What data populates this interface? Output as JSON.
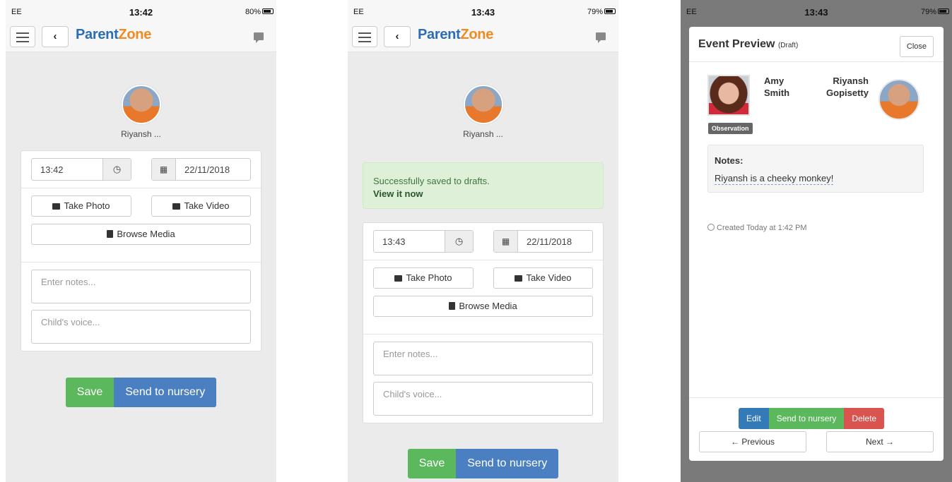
{
  "screens": [
    {
      "status": {
        "left": "EE",
        "time": "13:42",
        "right": "80%"
      },
      "brand": {
        "p": "Parent",
        "z": "Zone"
      },
      "child_name": "Riyansh ...",
      "time_value": "13:42",
      "date_value": "22/11/2018",
      "take_photo": "Take Photo",
      "take_video": "Take Video",
      "browse_media": "Browse Media",
      "notes_placeholder": "Enter notes...",
      "voice_placeholder": "Child's voice...",
      "save": "Save",
      "send": "Send to nursery"
    },
    {
      "status": {
        "left": "EE",
        "time": "13:43",
        "right": "79%"
      },
      "brand": {
        "p": "Parent",
        "z": "Zone"
      },
      "child_name": "Riyansh ...",
      "alert_text": "Successfully saved to drafts.",
      "alert_link": "View it now",
      "time_value": "13:43",
      "date_value": "22/11/2018",
      "take_photo": "Take Photo",
      "take_video": "Take Video",
      "browse_media": "Browse Media",
      "notes_placeholder": "Enter notes...",
      "voice_placeholder": "Child's voice...",
      "save": "Save",
      "send": "Send to nursery"
    }
  ],
  "preview": {
    "status": {
      "left": "EE",
      "time": "13:43",
      "right": "79%"
    },
    "title": "Event Preview",
    "title_tag": "(Draft)",
    "close": "Close",
    "staff_first": "Amy",
    "staff_last": "Smith",
    "child_first": "Riyansh",
    "child_last": "Gopisetty",
    "badge": "Observation",
    "notes_label": "Notes:",
    "notes_value": "Riyansh is a cheeky monkey!",
    "created": "Created Today at 1:42 PM",
    "edit": "Edit",
    "send": "Send to nursery",
    "delete": "Delete",
    "previous": "Previous",
    "next": "Next"
  },
  "colors": {
    "brand_blue": "#2d6db4",
    "brand_orange": "#f08a22",
    "success": "#5cb85c",
    "primary": "#337ab7",
    "danger": "#d9534f"
  },
  "icons": [
    "menu-icon",
    "back-chevron-icon",
    "chat-icon",
    "clock-icon",
    "calendar-icon",
    "camera-icon",
    "film-icon",
    "file-icon"
  ]
}
